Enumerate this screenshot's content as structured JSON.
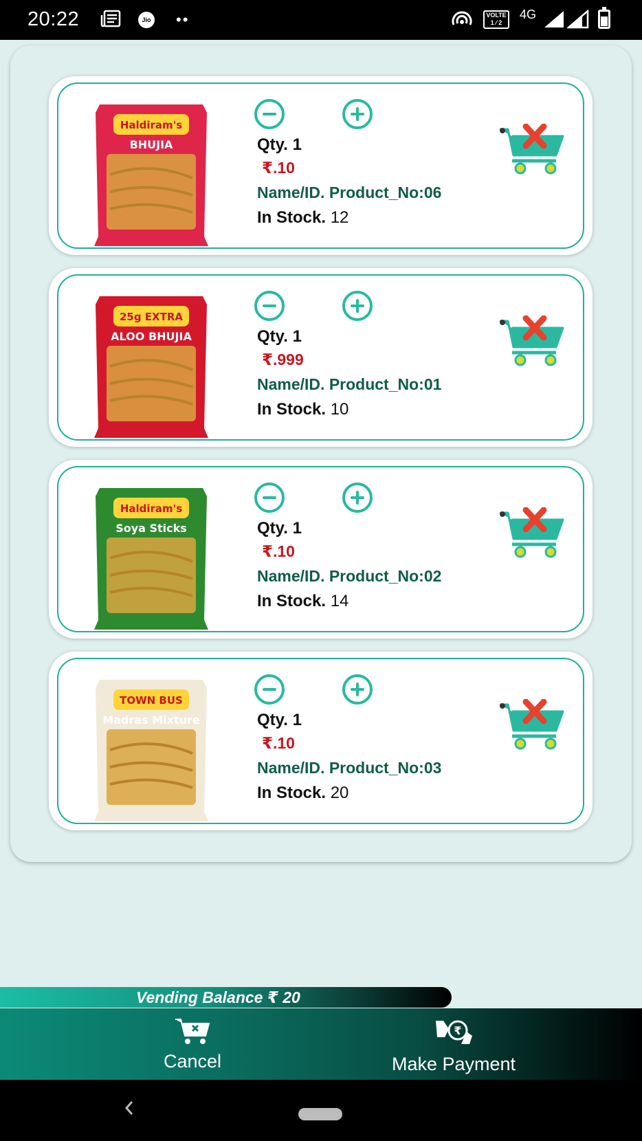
{
  "status_bar": {
    "time": "20:22",
    "icons": [
      "news-icon",
      "jio-icon",
      "more-dots-icon",
      "hotspot-icon",
      "volte-icon",
      "4g-icon",
      "signal-icon",
      "signal-icon",
      "battery-icon"
    ],
    "jio_label": "Jio",
    "dots": "••",
    "volte_label": "VOLTE",
    "volte_sub": "1 ⁄ 2",
    "network": "4G"
  },
  "cart": {
    "items": [
      {
        "qty_label": "Qty. 1",
        "price": "₹.10",
        "name": "Name/ID. Product_No:06",
        "stock_label": "In Stock.",
        "stock_value": "12",
        "image_icon": "snack-packet-bhujia-icon",
        "pack_color": "#e0254a",
        "pack_label": "Haldiram's",
        "pack_sub": "BHUJIA"
      },
      {
        "qty_label": "Qty. 1",
        "price": "₹.999",
        "name": "Name/ID. Product_No:01",
        "stock_label": "In Stock.",
        "stock_value": "10",
        "image_icon": "snack-packet-aloo-bhujia-icon",
        "pack_color": "#d3182c",
        "pack_label": "25g EXTRA",
        "pack_sub": "ALOO BHUJIA"
      },
      {
        "qty_label": "Qty. 1",
        "price": "₹.10",
        "name": "Name/ID. Product_No:02",
        "stock_label": "In Stock.",
        "stock_value": "14",
        "image_icon": "snack-packet-soya-sticks-icon",
        "pack_color": "#2e8a2f",
        "pack_label": "Haldiram's",
        "pack_sub": "Soya Sticks"
      },
      {
        "qty_label": "Qty. 1",
        "price": "₹.10",
        "name": "Name/ID. Product_No:03",
        "stock_label": "In Stock.",
        "stock_value": "20",
        "image_icon": "snack-packet-madras-mixture-icon",
        "pack_color": "#f2ead8",
        "pack_label": "TOWN BUS",
        "pack_sub": "Madras Mixture"
      }
    ]
  },
  "balance": {
    "label": "Vending Balance ₹ 20"
  },
  "actions": {
    "cancel_label": "Cancel",
    "payment_label": "Make Payment"
  },
  "colors": {
    "accent": "#2ab9a0",
    "price": "#c8161d",
    "name": "#105c4c",
    "background": "#deefed"
  }
}
